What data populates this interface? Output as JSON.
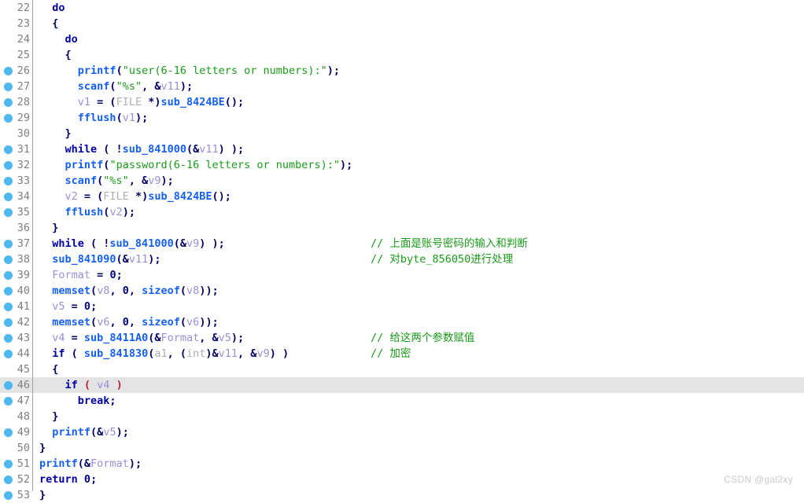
{
  "editor": {
    "app": "ida-pseudocode-view",
    "first_visible_line": 22,
    "current_line": 46,
    "colors": {
      "background": "#ffffff",
      "current_line_highlight": "#e4e4e4",
      "breakpoint_dot": "#4db8f0",
      "line_number": "#808080",
      "gutter_rule": "#a0a0a0",
      "keyword": "#0000a0",
      "function": "#1560f0",
      "variable": "#9a90d8",
      "type": "#b0b0b0",
      "string": "#1a9b1a",
      "comment": "#1a9b1a",
      "number": "#000080",
      "paren": "#b02040"
    },
    "lines": [
      {
        "number": "22",
        "breakpoint": false,
        "current": false,
        "tokens": [
          {
            "t": "  ",
            "c": "plain"
          },
          {
            "t": "do",
            "c": "kw"
          }
        ],
        "comment": ""
      },
      {
        "number": "23",
        "breakpoint": false,
        "current": false,
        "tokens": [
          {
            "t": "  ",
            "c": "plain"
          },
          {
            "t": "{",
            "c": "punc"
          }
        ],
        "comment": ""
      },
      {
        "number": "24",
        "breakpoint": false,
        "current": false,
        "tokens": [
          {
            "t": "    ",
            "c": "plain"
          },
          {
            "t": "do",
            "c": "kw"
          }
        ],
        "comment": ""
      },
      {
        "number": "25",
        "breakpoint": false,
        "current": false,
        "tokens": [
          {
            "t": "    ",
            "c": "plain"
          },
          {
            "t": "{",
            "c": "punc"
          }
        ],
        "comment": ""
      },
      {
        "number": "26",
        "breakpoint": true,
        "current": false,
        "tokens": [
          {
            "t": "      ",
            "c": "plain"
          },
          {
            "t": "printf",
            "c": "fn"
          },
          {
            "t": "(",
            "c": "punc"
          },
          {
            "t": "\"user(6-16 letters or numbers):\"",
            "c": "str"
          },
          {
            "t": ");",
            "c": "punc"
          }
        ],
        "comment": ""
      },
      {
        "number": "27",
        "breakpoint": true,
        "current": false,
        "tokens": [
          {
            "t": "      ",
            "c": "plain"
          },
          {
            "t": "scanf",
            "c": "fn"
          },
          {
            "t": "(",
            "c": "punc"
          },
          {
            "t": "\"%s\"",
            "c": "str"
          },
          {
            "t": ", &",
            "c": "punc"
          },
          {
            "t": "v11",
            "c": "var"
          },
          {
            "t": ");",
            "c": "punc"
          }
        ],
        "comment": ""
      },
      {
        "number": "28",
        "breakpoint": true,
        "current": false,
        "tokens": [
          {
            "t": "      ",
            "c": "plain"
          },
          {
            "t": "v1",
            "c": "var"
          },
          {
            "t": " = (",
            "c": "punc"
          },
          {
            "t": "FILE",
            "c": "type"
          },
          {
            "t": " *)",
            "c": "punc"
          },
          {
            "t": "sub_8424BE",
            "c": "fn"
          },
          {
            "t": "();",
            "c": "punc"
          }
        ],
        "comment": ""
      },
      {
        "number": "29",
        "breakpoint": true,
        "current": false,
        "tokens": [
          {
            "t": "      ",
            "c": "plain"
          },
          {
            "t": "fflush",
            "c": "fn"
          },
          {
            "t": "(",
            "c": "punc"
          },
          {
            "t": "v1",
            "c": "var"
          },
          {
            "t": ");",
            "c": "punc"
          }
        ],
        "comment": ""
      },
      {
        "number": "30",
        "breakpoint": false,
        "current": false,
        "tokens": [
          {
            "t": "    ",
            "c": "plain"
          },
          {
            "t": "}",
            "c": "punc"
          }
        ],
        "comment": ""
      },
      {
        "number": "31",
        "breakpoint": true,
        "current": false,
        "tokens": [
          {
            "t": "    ",
            "c": "plain"
          },
          {
            "t": "while",
            "c": "kw"
          },
          {
            "t": " ( !",
            "c": "punc"
          },
          {
            "t": "sub_841000",
            "c": "fn"
          },
          {
            "t": "(&",
            "c": "punc"
          },
          {
            "t": "v11",
            "c": "var"
          },
          {
            "t": ") );",
            "c": "punc"
          }
        ],
        "comment": ""
      },
      {
        "number": "32",
        "breakpoint": true,
        "current": false,
        "tokens": [
          {
            "t": "    ",
            "c": "plain"
          },
          {
            "t": "printf",
            "c": "fn"
          },
          {
            "t": "(",
            "c": "punc"
          },
          {
            "t": "\"password(6-16 letters or numbers):\"",
            "c": "str"
          },
          {
            "t": ");",
            "c": "punc"
          }
        ],
        "comment": ""
      },
      {
        "number": "33",
        "breakpoint": true,
        "current": false,
        "tokens": [
          {
            "t": "    ",
            "c": "plain"
          },
          {
            "t": "scanf",
            "c": "fn"
          },
          {
            "t": "(",
            "c": "punc"
          },
          {
            "t": "\"%s\"",
            "c": "str"
          },
          {
            "t": ", &",
            "c": "punc"
          },
          {
            "t": "v9",
            "c": "var"
          },
          {
            "t": ");",
            "c": "punc"
          }
        ],
        "comment": ""
      },
      {
        "number": "34",
        "breakpoint": true,
        "current": false,
        "tokens": [
          {
            "t": "    ",
            "c": "plain"
          },
          {
            "t": "v2",
            "c": "var"
          },
          {
            "t": " = (",
            "c": "punc"
          },
          {
            "t": "FILE",
            "c": "type"
          },
          {
            "t": " *)",
            "c": "punc"
          },
          {
            "t": "sub_8424BE",
            "c": "fn"
          },
          {
            "t": "();",
            "c": "punc"
          }
        ],
        "comment": ""
      },
      {
        "number": "35",
        "breakpoint": true,
        "current": false,
        "tokens": [
          {
            "t": "    ",
            "c": "plain"
          },
          {
            "t": "fflush",
            "c": "fn"
          },
          {
            "t": "(",
            "c": "punc"
          },
          {
            "t": "v2",
            "c": "var"
          },
          {
            "t": ");",
            "c": "punc"
          }
        ],
        "comment": ""
      },
      {
        "number": "36",
        "breakpoint": false,
        "current": false,
        "tokens": [
          {
            "t": "  ",
            "c": "plain"
          },
          {
            "t": "}",
            "c": "punc"
          }
        ],
        "comment": ""
      },
      {
        "number": "37",
        "breakpoint": true,
        "current": false,
        "tokens": [
          {
            "t": "  ",
            "c": "plain"
          },
          {
            "t": "while",
            "c": "kw"
          },
          {
            "t": " ( !",
            "c": "punc"
          },
          {
            "t": "sub_841000",
            "c": "fn"
          },
          {
            "t": "(&",
            "c": "punc"
          },
          {
            "t": "v9",
            "c": "var"
          },
          {
            "t": ") );",
            "c": "punc"
          }
        ],
        "comment": "// 上面是账号密码的输入和判断"
      },
      {
        "number": "38",
        "breakpoint": true,
        "current": false,
        "tokens": [
          {
            "t": "  ",
            "c": "plain"
          },
          {
            "t": "sub_841090",
            "c": "fn"
          },
          {
            "t": "(&",
            "c": "punc"
          },
          {
            "t": "v11",
            "c": "var"
          },
          {
            "t": ");",
            "c": "punc"
          }
        ],
        "comment": "// 对byte_856050进行处理"
      },
      {
        "number": "39",
        "breakpoint": true,
        "current": false,
        "tokens": [
          {
            "t": "  ",
            "c": "plain"
          },
          {
            "t": "Format",
            "c": "var"
          },
          {
            "t": " = ",
            "c": "punc"
          },
          {
            "t": "0",
            "c": "num"
          },
          {
            "t": ";",
            "c": "punc"
          }
        ],
        "comment": ""
      },
      {
        "number": "40",
        "breakpoint": true,
        "current": false,
        "tokens": [
          {
            "t": "  ",
            "c": "plain"
          },
          {
            "t": "memset",
            "c": "fn"
          },
          {
            "t": "(",
            "c": "punc"
          },
          {
            "t": "v8",
            "c": "var"
          },
          {
            "t": ", ",
            "c": "punc"
          },
          {
            "t": "0",
            "c": "num"
          },
          {
            "t": ", ",
            "c": "punc"
          },
          {
            "t": "sizeof",
            "c": "fn"
          },
          {
            "t": "(",
            "c": "punc"
          },
          {
            "t": "v8",
            "c": "var"
          },
          {
            "t": "));",
            "c": "punc"
          }
        ],
        "comment": ""
      },
      {
        "number": "41",
        "breakpoint": true,
        "current": false,
        "tokens": [
          {
            "t": "  ",
            "c": "plain"
          },
          {
            "t": "v5",
            "c": "var"
          },
          {
            "t": " = ",
            "c": "punc"
          },
          {
            "t": "0",
            "c": "num"
          },
          {
            "t": ";",
            "c": "punc"
          }
        ],
        "comment": ""
      },
      {
        "number": "42",
        "breakpoint": true,
        "current": false,
        "tokens": [
          {
            "t": "  ",
            "c": "plain"
          },
          {
            "t": "memset",
            "c": "fn"
          },
          {
            "t": "(",
            "c": "punc"
          },
          {
            "t": "v6",
            "c": "var"
          },
          {
            "t": ", ",
            "c": "punc"
          },
          {
            "t": "0",
            "c": "num"
          },
          {
            "t": ", ",
            "c": "punc"
          },
          {
            "t": "sizeof",
            "c": "fn"
          },
          {
            "t": "(",
            "c": "punc"
          },
          {
            "t": "v6",
            "c": "var"
          },
          {
            "t": "));",
            "c": "punc"
          }
        ],
        "comment": ""
      },
      {
        "number": "43",
        "breakpoint": true,
        "current": false,
        "tokens": [
          {
            "t": "  ",
            "c": "plain"
          },
          {
            "t": "v4",
            "c": "var"
          },
          {
            "t": " = ",
            "c": "punc"
          },
          {
            "t": "sub_8411A0",
            "c": "fn"
          },
          {
            "t": "(&",
            "c": "punc"
          },
          {
            "t": "Format",
            "c": "var"
          },
          {
            "t": ", &",
            "c": "punc"
          },
          {
            "t": "v5",
            "c": "var"
          },
          {
            "t": ");",
            "c": "punc"
          }
        ],
        "comment": "// 给这两个参数赋值"
      },
      {
        "number": "44",
        "breakpoint": true,
        "current": false,
        "tokens": [
          {
            "t": "  ",
            "c": "plain"
          },
          {
            "t": "if",
            "c": "kw"
          },
          {
            "t": " ( ",
            "c": "punc"
          },
          {
            "t": "sub_841830",
            "c": "fn"
          },
          {
            "t": "(",
            "c": "punc"
          },
          {
            "t": "a1",
            "c": "type"
          },
          {
            "t": ", (",
            "c": "punc"
          },
          {
            "t": "int",
            "c": "type"
          },
          {
            "t": ")&",
            "c": "punc"
          },
          {
            "t": "v11",
            "c": "var"
          },
          {
            "t": ", &",
            "c": "punc"
          },
          {
            "t": "v9",
            "c": "var"
          },
          {
            "t": ") )",
            "c": "punc"
          }
        ],
        "comment": "// 加密"
      },
      {
        "number": "45",
        "breakpoint": false,
        "current": false,
        "tokens": [
          {
            "t": "  ",
            "c": "plain"
          },
          {
            "t": "{",
            "c": "punc"
          }
        ],
        "comment": ""
      },
      {
        "number": "46",
        "breakpoint": true,
        "current": true,
        "tokens": [
          {
            "t": "    ",
            "c": "plain"
          },
          {
            "t": "if",
            "c": "kw"
          },
          {
            "t": " ",
            "c": "punc"
          },
          {
            "t": "(",
            "c": "paren"
          },
          {
            "t": " ",
            "c": "punc"
          },
          {
            "t": "v4",
            "c": "var"
          },
          {
            "t": " ",
            "c": "punc"
          },
          {
            "t": ")",
            "c": "paren"
          }
        ],
        "comment": ""
      },
      {
        "number": "47",
        "breakpoint": true,
        "current": false,
        "tokens": [
          {
            "t": "      ",
            "c": "plain"
          },
          {
            "t": "break",
            "c": "kw"
          },
          {
            "t": ";",
            "c": "punc"
          }
        ],
        "comment": ""
      },
      {
        "number": "48",
        "breakpoint": false,
        "current": false,
        "tokens": [
          {
            "t": "  ",
            "c": "plain"
          },
          {
            "t": "}",
            "c": "punc"
          }
        ],
        "comment": ""
      },
      {
        "number": "49",
        "breakpoint": true,
        "current": false,
        "tokens": [
          {
            "t": "  ",
            "c": "plain"
          },
          {
            "t": "printf",
            "c": "fn"
          },
          {
            "t": "(&",
            "c": "punc"
          },
          {
            "t": "v5",
            "c": "var"
          },
          {
            "t": ");",
            "c": "punc"
          }
        ],
        "comment": ""
      },
      {
        "number": "50",
        "breakpoint": false,
        "current": false,
        "tokens": [
          {
            "t": "",
            "c": "plain"
          },
          {
            "t": "}",
            "c": "punc"
          }
        ],
        "comment": ""
      },
      {
        "number": "51",
        "breakpoint": true,
        "current": false,
        "tokens": [
          {
            "t": "",
            "c": "plain"
          },
          {
            "t": "printf",
            "c": "fn"
          },
          {
            "t": "(&",
            "c": "punc"
          },
          {
            "t": "Format",
            "c": "var"
          },
          {
            "t": ");",
            "c": "punc"
          }
        ],
        "comment": ""
      },
      {
        "number": "52",
        "breakpoint": true,
        "current": false,
        "tokens": [
          {
            "t": "",
            "c": "plain"
          },
          {
            "t": "return",
            "c": "kw"
          },
          {
            "t": " ",
            "c": "punc"
          },
          {
            "t": "0",
            "c": "num"
          },
          {
            "t": ";",
            "c": "punc"
          }
        ],
        "comment": ""
      },
      {
        "number": "53",
        "breakpoint": true,
        "current": false,
        "tokens": [
          {
            "t": "",
            "c": "plain"
          },
          {
            "t": "}",
            "c": "punc"
          }
        ],
        "comment": ""
      }
    ]
  },
  "watermark": {
    "text": "CSDN @gal2xy"
  }
}
